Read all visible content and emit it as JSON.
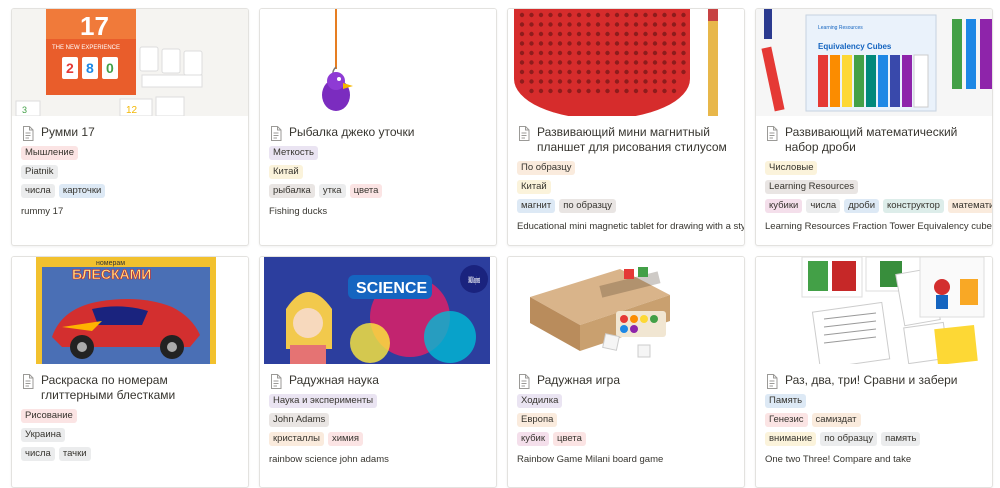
{
  "cards": [
    {
      "title": "Румми 17",
      "category": "Мышление",
      "brand": "Piatnik",
      "tags": [
        "числа",
        "карточки"
      ],
      "desc": "rummy 17"
    },
    {
      "title": "Рыбалка джеко уточки",
      "category": "Меткость",
      "brand": "Китай",
      "tags": [
        "рыбалка",
        "утка",
        "цвета"
      ],
      "desc": "Fishing ducks"
    },
    {
      "title": "Развивающий мини магнитный планшет для рисования стилусом",
      "category": "По образцу",
      "brand": "Китай",
      "tags": [
        "магнит",
        "по образцу"
      ],
      "desc": "Educational mini magnetic tablet for drawing with a stylus"
    },
    {
      "title": "Развивающий математический набор дроби",
      "category": "Числовые",
      "brand": "Learning Resources",
      "tags": [
        "кубики",
        "числа",
        "дроби",
        "конструктор",
        "математика"
      ],
      "desc": "Learning Resources Fraction Tower Equivalency cubes"
    },
    {
      "title": "Раскраска по номерам глиттерными блестками",
      "category": "Рисование",
      "brand": "Украина",
      "tags": [
        "числа",
        "тачки"
      ],
      "desc": ""
    },
    {
      "title": "Радужная наука",
      "category": "Наука и эксперименты",
      "brand": "John Adams",
      "tags": [
        "кристаллы",
        "химия"
      ],
      "desc": "rainbow science john adams"
    },
    {
      "title": "Радужная игра",
      "category": "Ходилка",
      "brand": "Европа",
      "tags": [
        "кубик",
        "цвета"
      ],
      "desc": "Rainbow Game Milani board game"
    },
    {
      "title": "Раз, два, три! Сравни и забери",
      "category": "Память",
      "brand": "Генезис",
      "tags": [
        "внимание",
        "по образцу",
        "память"
      ],
      "brand2": "самиздат",
      "desc": "One two Three! Compare and take"
    }
  ],
  "cover_text": {
    "rummy_number": "17",
    "rummy_tagline": "THE NEW EXPERIENCE",
    "cubes_title": "Equivalency Cubes",
    "cubes_brand": "Learning Resources",
    "coloring_top": "номерам",
    "coloring_title": "БЛЕСКАМИ",
    "science_title": "SCIENCE",
    "science_badge": "5 AMAZING experiments"
  },
  "colors": {
    "card_border": "#e3e2df",
    "text": "#37352f",
    "tag_red": "#fbe4e4",
    "tag_purple": "#eae4f2",
    "tag_orange": "#faebdd",
    "tag_yellow": "#fbf3db",
    "tag_gray": "#ebeced",
    "tag_blue": "#dde9f5",
    "tag_green": "#ddedea",
    "tag_brown": "#e9e5e3",
    "tag_pink": "#f4dfeb"
  },
  "icons": [
    "document-icon"
  ]
}
